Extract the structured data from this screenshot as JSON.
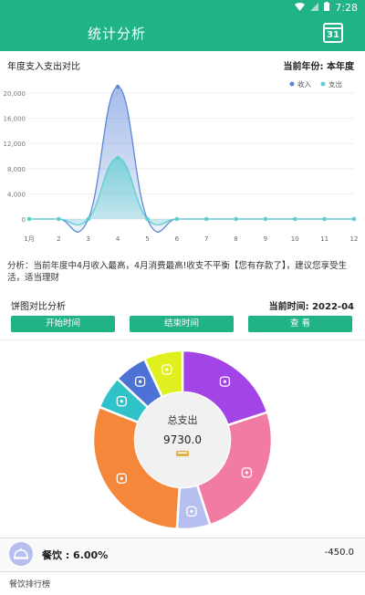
{
  "status_bar": {
    "time": "7:28"
  },
  "app_bar": {
    "title": "统计分析",
    "calendar_day": "31"
  },
  "line_section": {
    "title": "年度支入支出对比",
    "year_label": "当前年份: 本年度"
  },
  "chart_data": {
    "type": "line",
    "x": [
      1,
      2,
      3,
      4,
      5,
      6,
      7,
      8,
      9,
      10,
      11,
      12
    ],
    "x_tick_labels": [
      "1月",
      "2",
      "3",
      "4",
      "5",
      "6",
      "7",
      "8",
      "9",
      "10",
      "11",
      "12"
    ],
    "y_tick_labels": [
      "0",
      "4,000",
      "8,000",
      "12,000",
      "16,000",
      "20,000"
    ],
    "ylim": [
      0,
      20000
    ],
    "legend_position": "top-right",
    "grid": true,
    "series": [
      {
        "name": "收入",
        "values": [
          0,
          0,
          0,
          21000,
          0,
          0,
          0,
          0,
          0,
          0,
          0,
          0
        ],
        "color": "#5b86d8"
      },
      {
        "name": "支出",
        "values": [
          0,
          0,
          0,
          9700,
          0,
          0,
          0,
          0,
          0,
          0,
          0,
          0
        ],
        "color": "#5ecfd0"
      }
    ]
  },
  "analysis": {
    "text": "分析：当前年度中4月收入最高，4月消费最高!收支不平衡【您有存款了】，建议您享受生活，适当理财"
  },
  "pie_section": {
    "title": "饼图对比分析",
    "time_label": "当前时间: 2022-04",
    "buttons": {
      "start": "开始时间",
      "end": "结束时间",
      "view": "查 看"
    },
    "center_label": "总支出",
    "center_value": "9730.0",
    "slices": [
      {
        "icon": "baby-icon",
        "fraction": 0.2,
        "color": "#a344e6"
      },
      {
        "icon": "clothing-icon",
        "fraction": 0.25,
        "color": "#f27ba4"
      },
      {
        "icon": "dining-icon",
        "fraction": 0.06,
        "color": "#b7bff0"
      },
      {
        "icon": "daily-use-icon",
        "fraction": 0.3,
        "color": "#f5873a"
      },
      {
        "icon": "mail-icon",
        "fraction": 0.06,
        "color": "#2fc2c8"
      },
      {
        "icon": "bicycle-icon",
        "fraction": 0.06,
        "color": "#4d72d6"
      },
      {
        "icon": "ball-icon",
        "fraction": 0.07,
        "color": "#dff01e"
      }
    ]
  },
  "detail": {
    "label": "餐饮 : 6.00%",
    "amount": "-450.0"
  },
  "ranking": {
    "title": "餐饮排行榜"
  },
  "colors": {
    "primary": "#1fb385"
  }
}
